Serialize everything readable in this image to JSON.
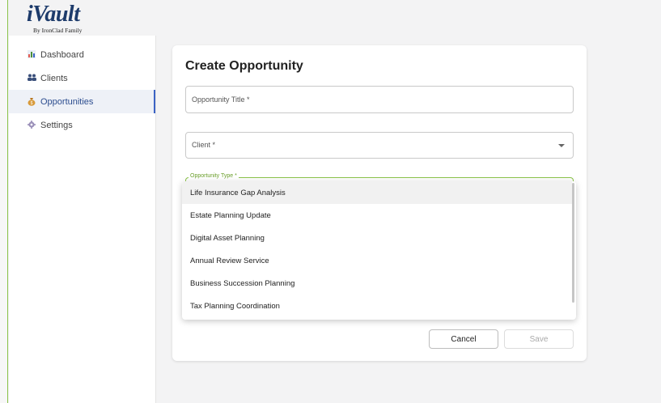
{
  "brand": {
    "logo_main": "iVault",
    "logo_sub": "By IronClad Family"
  },
  "sidebar": {
    "items": [
      {
        "label": "Dashboard",
        "icon": "bar-chart-icon"
      },
      {
        "label": "Clients",
        "icon": "users-icon"
      },
      {
        "label": "Opportunities",
        "icon": "moneybag-icon",
        "active": true
      },
      {
        "label": "Settings",
        "icon": "gear-icon"
      }
    ]
  },
  "form": {
    "title": "Create Opportunity",
    "opportunity_title_placeholder": "Opportunity Title *",
    "client_placeholder": "Client *",
    "opportunity_type_label": "Opportunity Type *",
    "type_options": [
      "Life Insurance Gap Analysis",
      "Estate Planning Update",
      "Digital Asset Planning",
      "Annual Review Service",
      "Business Succession Planning",
      "Tax Planning Coordination"
    ],
    "cancel_label": "Cancel",
    "save_label": "Save"
  },
  "colors": {
    "accent": "#3b63c4",
    "focus": "#8bc34a",
    "brand": "#1d3b6b"
  }
}
